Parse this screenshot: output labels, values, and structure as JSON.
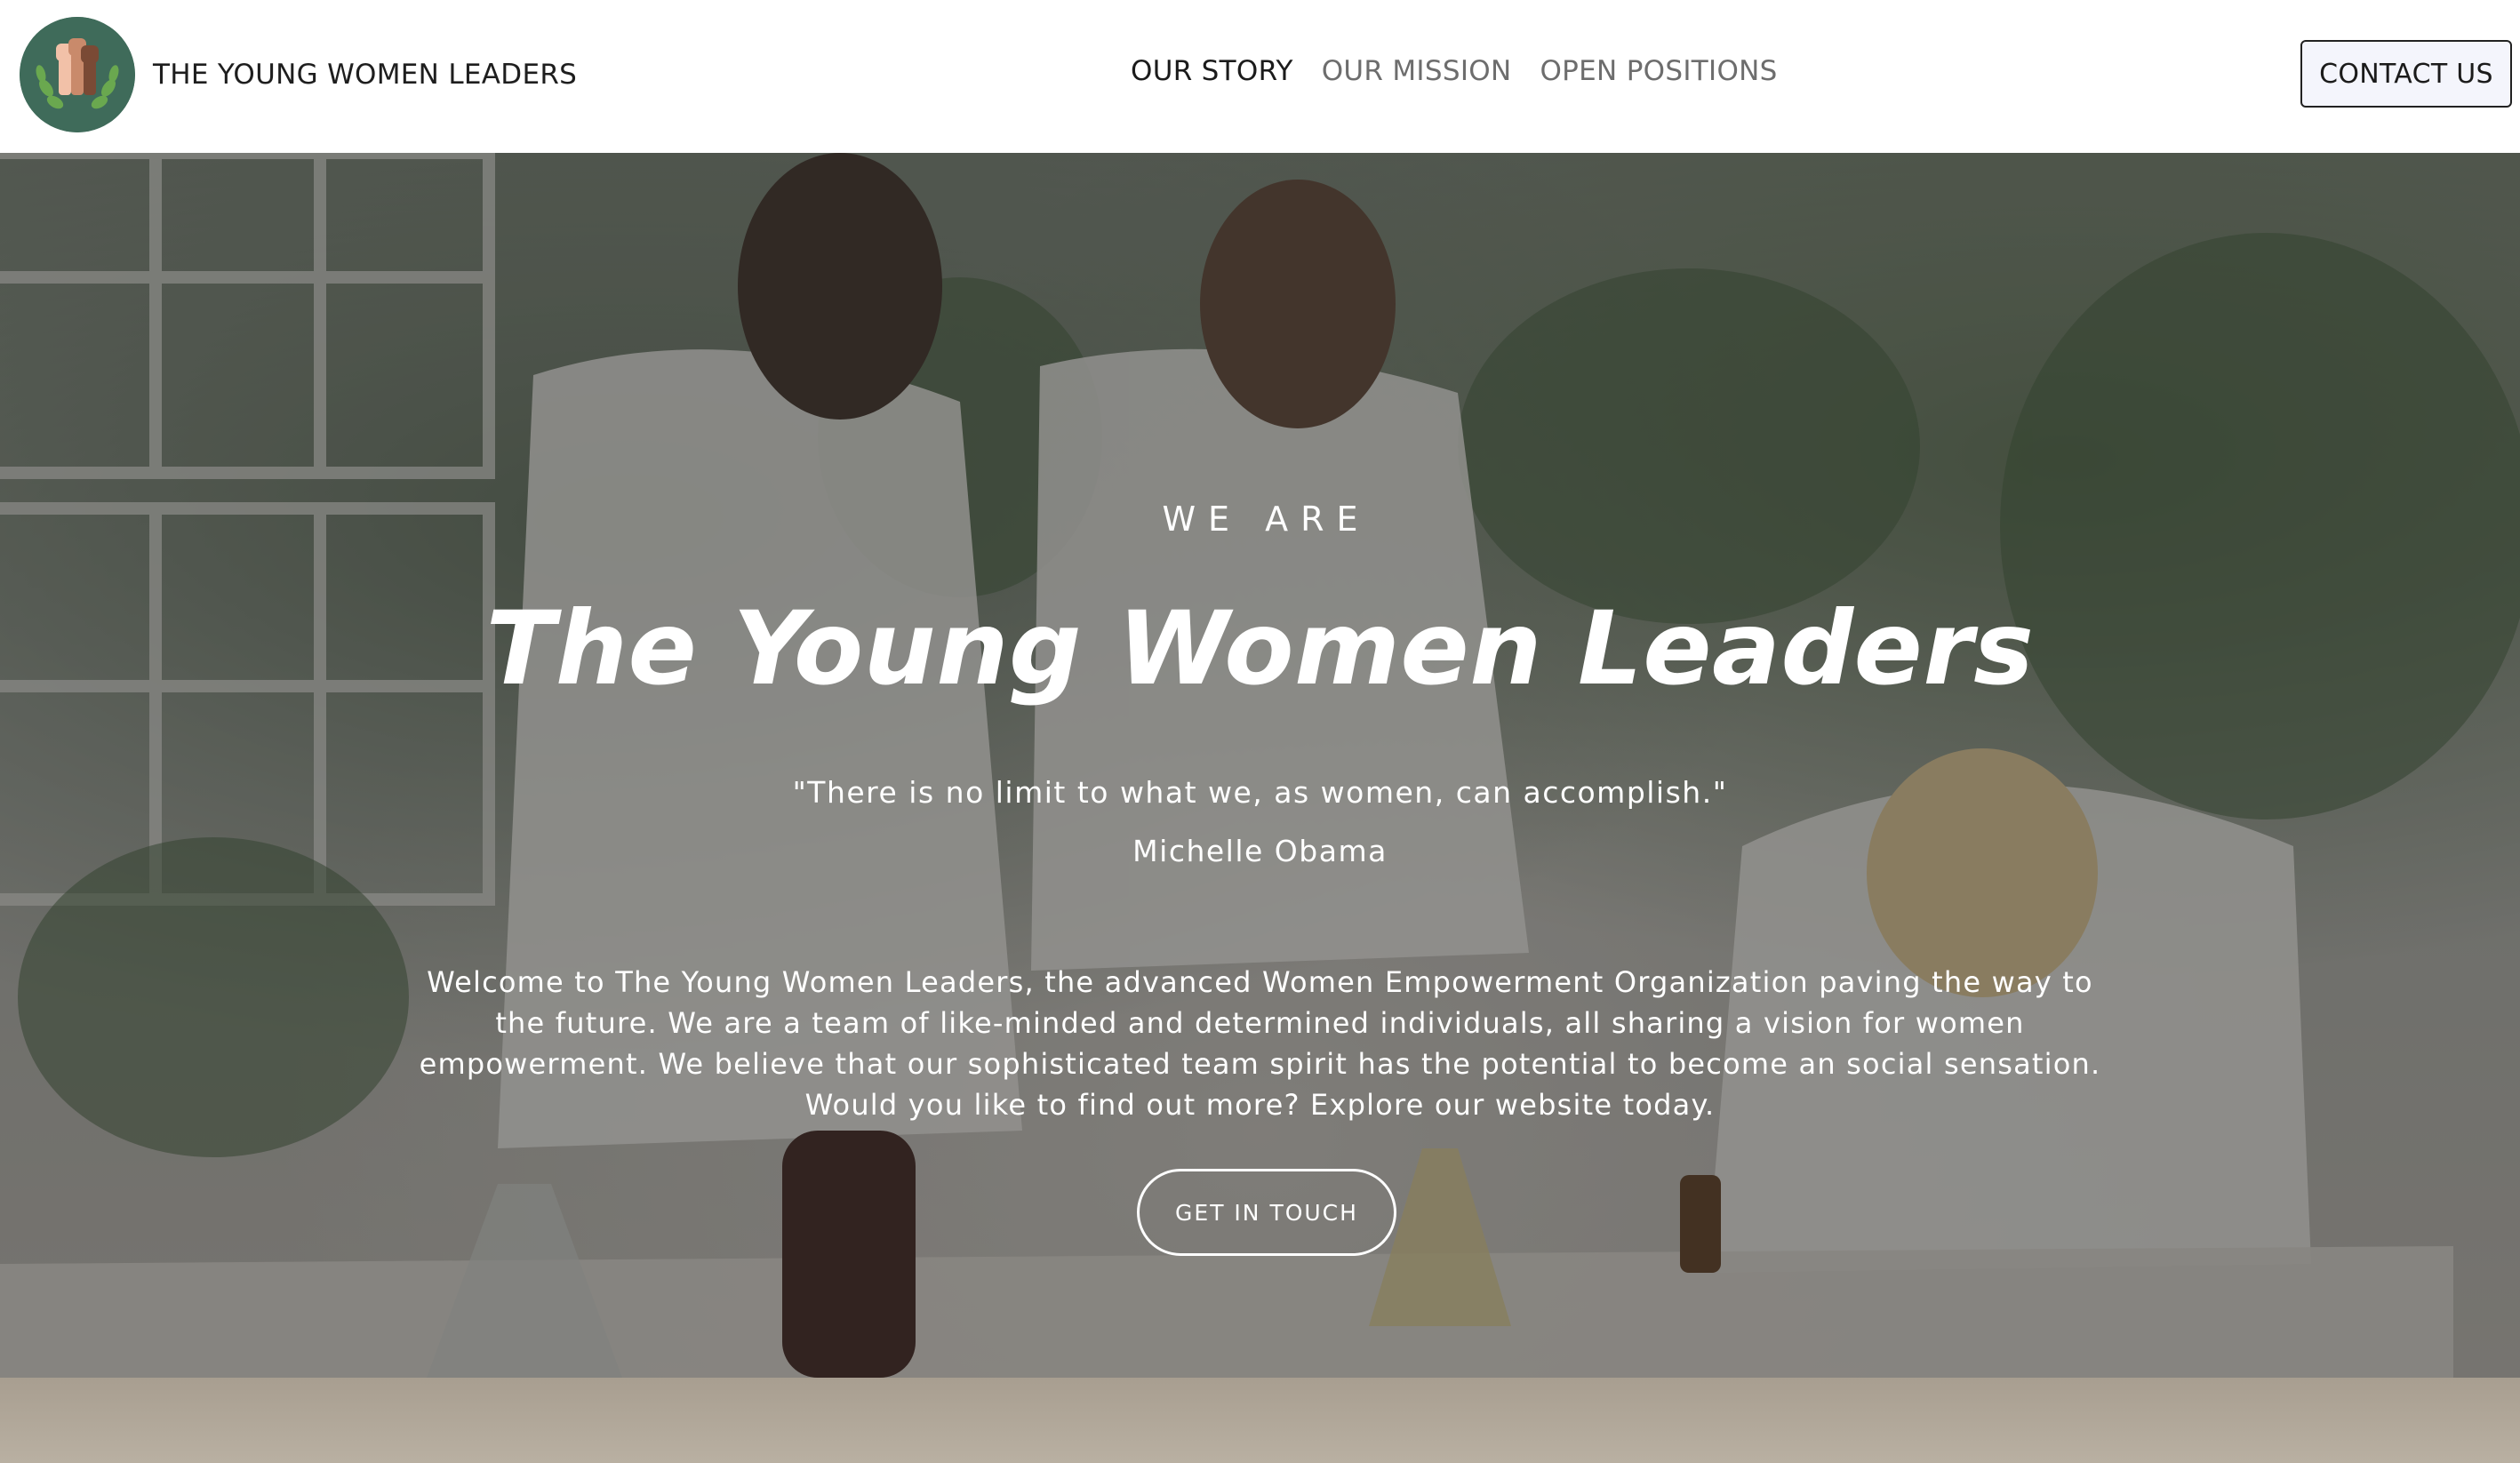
{
  "header": {
    "brand_name": "THE YOUNG WOMEN LEADERS",
    "logo_icon": "raised-fists-laurel-icon",
    "nav": [
      {
        "label": "OUR STORY",
        "active": true
      },
      {
        "label": "OUR MISSION",
        "active": false
      },
      {
        "label": "OPEN POSITIONS",
        "active": false
      }
    ],
    "contact_label": "CONTACT US"
  },
  "hero": {
    "eyebrow": "WE ARE",
    "title": "The Young Women Leaders",
    "quote": "\"There is no limit to what we, as women, can accomplish.\"",
    "quote_author": "Michelle Obama",
    "intro": "Welcome to The Young Women Leaders, the advanced Women Empowerment Organization paving the way to the future. We are a team of like-minded and determined individuals, all sharing a vision for women empowerment. We believe that our sophisticated team spirit has the potential to become an social sensation. Would you like to find out more? Explore our website today.",
    "cta_label": "GET IN TOUCH",
    "background_image": "women-scientists-lab-photo"
  },
  "colors": {
    "logo_bg": "#3f6b5a",
    "nav_active": "#1b1b1b",
    "nav_inactive": "#6d6d6d",
    "contact_bg": "#f4f5fc",
    "hero_text": "#ffffff"
  }
}
